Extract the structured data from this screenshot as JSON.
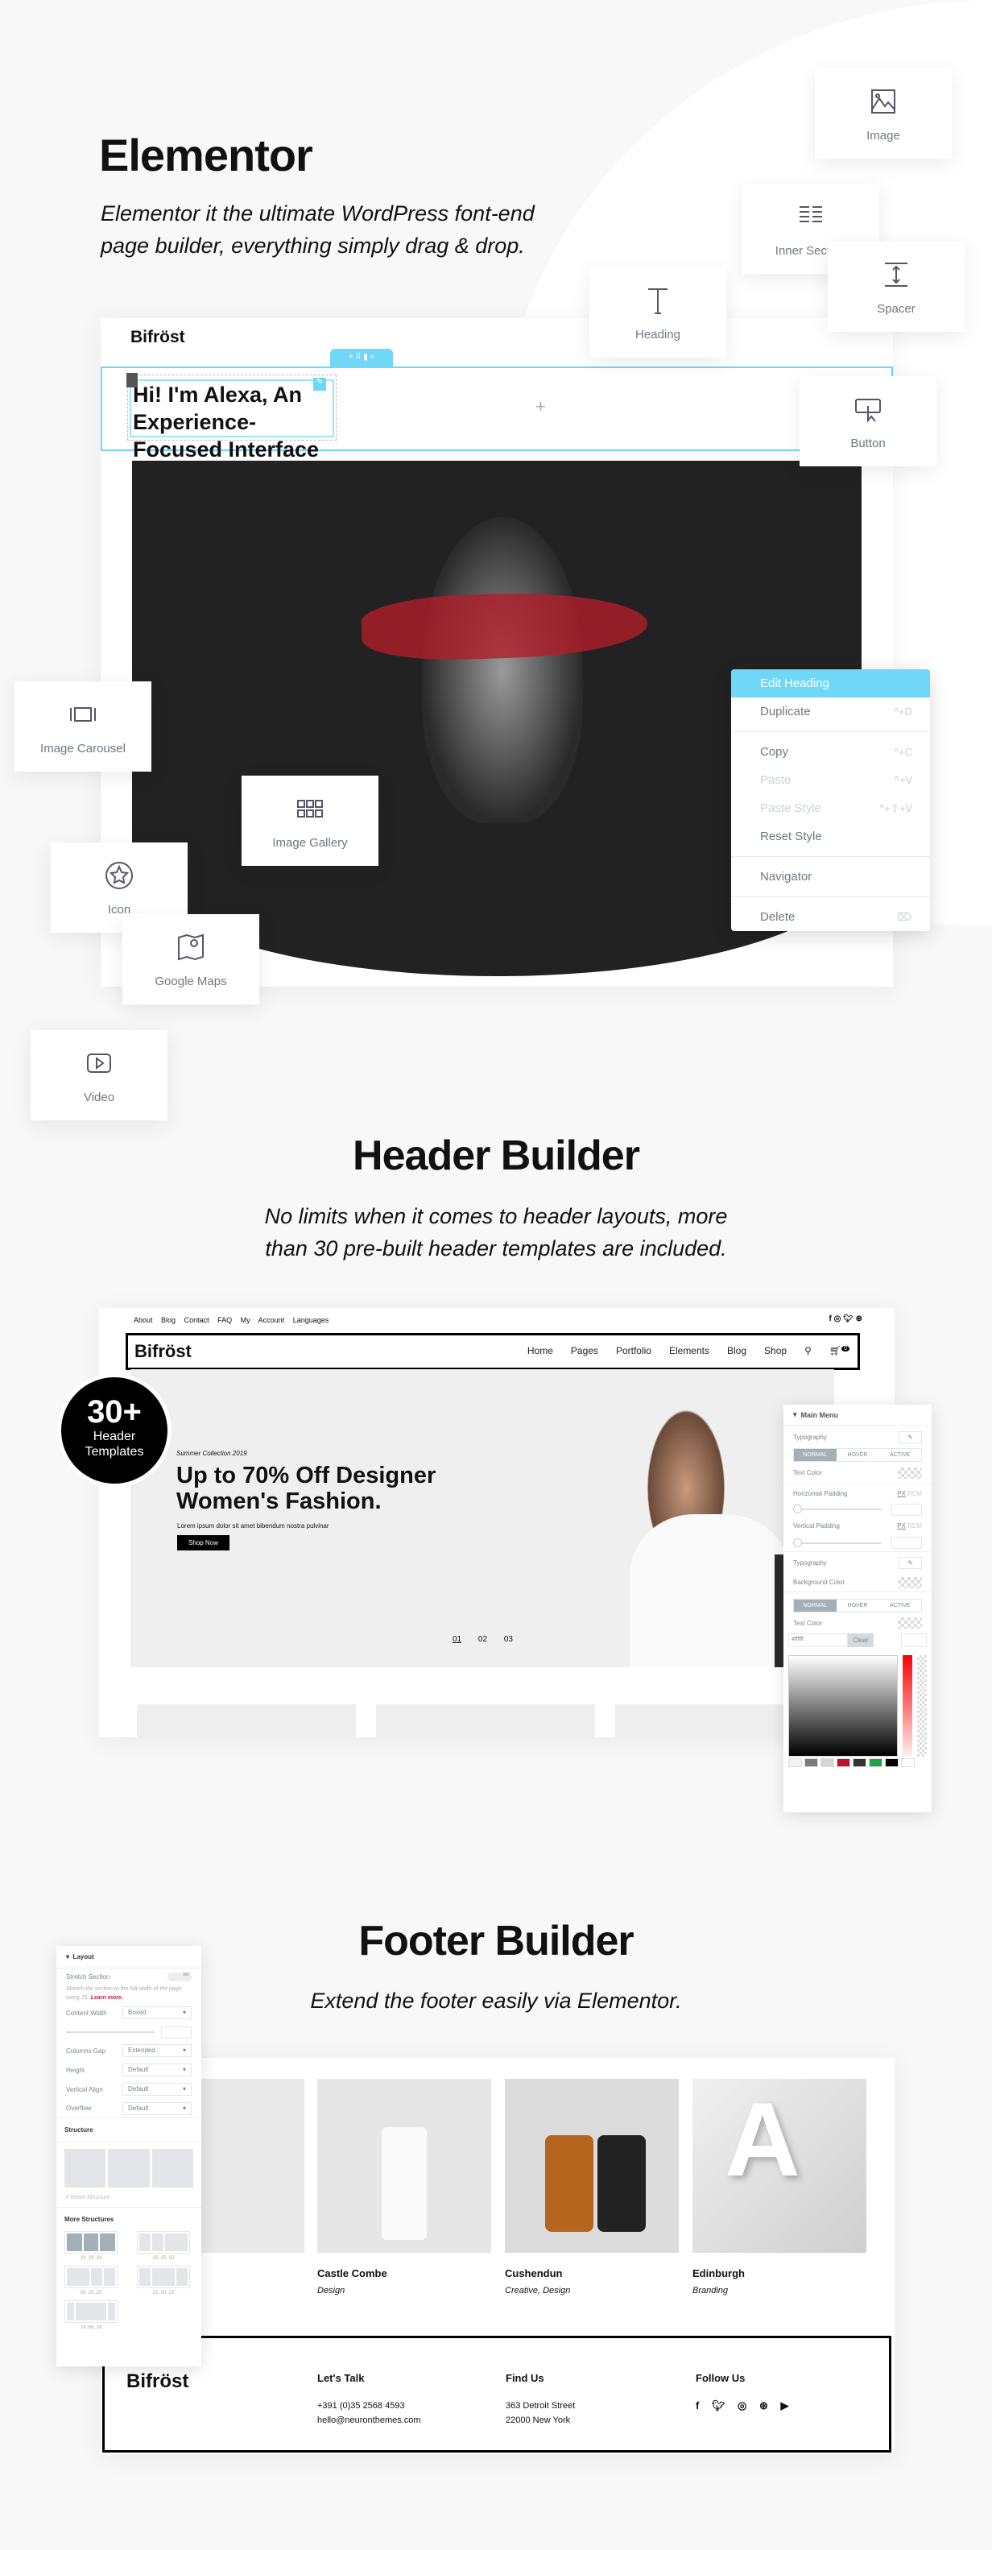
{
  "elementor": {
    "title": "Elementor",
    "subtitle_line1": "Elementor it the ultimate WordPress font-end",
    "subtitle_line2": "page builder, everything simply drag & drop.",
    "widgets": {
      "image": "Image",
      "inner_section": "Inner Section",
      "spacer": "Spacer",
      "heading": "Heading",
      "button": "Button",
      "image_carousel": "Image Carousel",
      "image_gallery": "Image Gallery",
      "icon": "Icon",
      "google_maps": "Google Maps",
      "video": "Video"
    },
    "preview": {
      "logo": "Bifröst",
      "heading_line1": "Hi! I'm Alexa, An Experience-",
      "heading_line2": "Focused Interface Designer",
      "add": "+"
    },
    "context_menu": [
      {
        "label": "Edit Heading",
        "shortcut": ""
      },
      {
        "label": "Duplicate",
        "shortcut": "^+D"
      },
      {
        "label": "Copy",
        "shortcut": "^+C"
      },
      {
        "label": "Paste",
        "shortcut": "^+V"
      },
      {
        "label": "Paste Style",
        "shortcut": "^+⇧+V"
      },
      {
        "label": "Reset Style",
        "shortcut": ""
      },
      {
        "label": "Navigator",
        "shortcut": ""
      },
      {
        "label": "Delete",
        "shortcut": "⌦"
      }
    ],
    "accent": "#71d7f7"
  },
  "header_builder": {
    "title": "Header Builder",
    "subtitle_line1": "No limits when it comes to header layouts, more",
    "subtitle_line2": "than 30 pre-built header templates are included.",
    "badge": {
      "count": "30+",
      "line1": "Header",
      "line2": "Templates"
    },
    "topbar": [
      "About",
      "Blog",
      "Contact",
      "FAQ",
      "My Account",
      "Languages"
    ],
    "logo": "Bifröst",
    "nav": [
      "Home",
      "Pages",
      "Portfolio",
      "Elements",
      "Blog",
      "Shop"
    ],
    "cart_count": "0",
    "hero": {
      "kicker": "Summer Collection 2019",
      "title_line1": "Up to 70% Off Designer",
      "title_line2": "Women's Fashion.",
      "text": "Lorem ipsum dolor sit amet bibendum nostra pulvinar",
      "button": "Shop Now",
      "slides": [
        "01",
        "02",
        "03"
      ]
    },
    "panel": {
      "title": "Main Menu",
      "typography": "Typography",
      "tabs": [
        "NORMAL",
        "HOVER",
        "ACTIVE"
      ],
      "text_color": "Text Color",
      "h_padding": "Horizontal Padding",
      "v_padding": "Vertical Padding",
      "unit_px": "PX",
      "unit_rem": "REM",
      "bg_color": "Background Color",
      "hex": "#ffffff",
      "clear": "Clear",
      "swatches": [
        "#f1f3f5",
        "#7a7a7a",
        "#d5d5d5",
        "#c2102c",
        "#333333",
        "#1ea446",
        "#000000",
        "#ffffff"
      ]
    }
  },
  "footer_builder": {
    "title": "Footer Builder",
    "subtitle": "Extend the footer easily via Elementor.",
    "projects": [
      {
        "title": "Castle Combe",
        "cat": "Design"
      },
      {
        "title": "Cushendun",
        "cat": "Creative, Design"
      },
      {
        "title": "Edinburgh",
        "cat": "Branding"
      }
    ],
    "footer": {
      "logo": "Bifröst",
      "talk_title": "Let's Talk",
      "phone": "+391 (0)35 2568 4593",
      "email": "hello@neuronthemes.com",
      "find_title": "Find Us",
      "addr1": "363 Detroit Street",
      "addr2": "22000 New York",
      "follow_title": "Follow Us"
    },
    "layout_panel": {
      "title": "Layout",
      "stretch": "Stretch Section",
      "toggle": "NO",
      "help": "Stretch the section to the full width of the page using JS.",
      "learn": "Learn more.",
      "content_width": "Content Width",
      "content_width_val": "Boxed",
      "columns_gap": "Columns Gap",
      "columns_gap_val": "Extended",
      "height": "Height",
      "height_val": "Default",
      "valign": "Vertical Align",
      "valign_val": "Default",
      "overflow": "Overflow",
      "overflow_val": "Default",
      "structure": "Structure",
      "reset": "Reset Structure",
      "more": "More Structures",
      "presets": [
        "33, 33, 33",
        "25, 25, 50",
        "50, 25, 25",
        "25, 50, 25",
        "16, 66, 16"
      ]
    }
  }
}
